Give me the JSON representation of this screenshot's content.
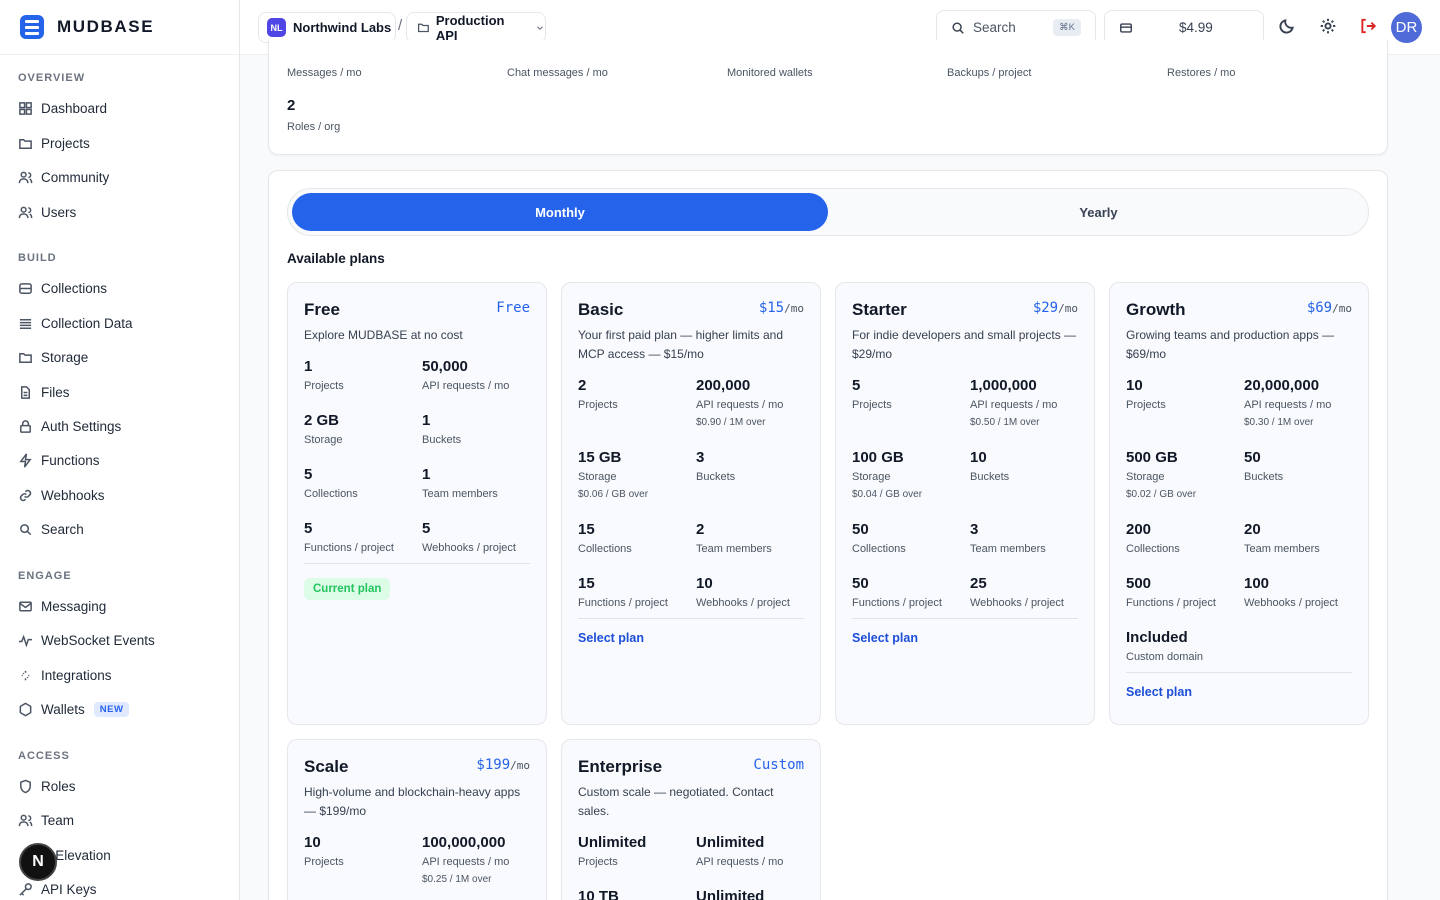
{
  "brand": {
    "name": "MUDBASE"
  },
  "sidebar": {
    "sections": [
      {
        "title": "OVERVIEW",
        "items": [
          {
            "label": "Dashboard",
            "icon": "grid-icon"
          },
          {
            "label": "Projects",
            "icon": "folder-icon"
          },
          {
            "label": "Community",
            "icon": "users-icon"
          },
          {
            "label": "Users",
            "icon": "users-icon"
          }
        ]
      },
      {
        "title": "BUILD",
        "items": [
          {
            "label": "Collections",
            "icon": "database-icon"
          },
          {
            "label": "Collection Data",
            "icon": "list-icon"
          },
          {
            "label": "Storage",
            "icon": "folder-icon"
          },
          {
            "label": "Files",
            "icon": "file-icon"
          },
          {
            "label": "Auth Settings",
            "icon": "lock-icon"
          },
          {
            "label": "Functions",
            "icon": "bolt-icon"
          },
          {
            "label": "Webhooks",
            "icon": "link-icon"
          },
          {
            "label": "Search",
            "icon": "search-icon"
          }
        ]
      },
      {
        "title": "ENGAGE",
        "items": [
          {
            "label": "Messaging",
            "icon": "mail-icon"
          },
          {
            "label": "WebSocket Events",
            "icon": "activity-icon"
          },
          {
            "label": "Integrations",
            "icon": "sparkle-icon"
          },
          {
            "label": "Wallets",
            "icon": "hexagon-icon",
            "badge": "NEW"
          }
        ]
      },
      {
        "title": "ACCESS",
        "items": [
          {
            "label": "Roles",
            "icon": "shield-icon"
          },
          {
            "label": "Team",
            "icon": "users-icon"
          },
          {
            "label": "le Elevation",
            "icon": ""
          },
          {
            "label": "API Keys",
            "icon": "key-icon"
          }
        ]
      }
    ],
    "fab_label": "N"
  },
  "topbar": {
    "org_initials": "NL",
    "org_name": "Northwind Labs",
    "separator": "/",
    "project_name": "Production API",
    "search_label": "Search",
    "search_shortcut": "⌘K",
    "credit": "$4.99",
    "user_initials": "DR"
  },
  "usage": {
    "row1": [
      {
        "label": "Messages / mo"
      },
      {
        "label": "Chat messages / mo"
      },
      {
        "label": "Monitored wallets"
      },
      {
        "label": "Backups / project"
      },
      {
        "label": "Restores / mo"
      }
    ],
    "row2": [
      {
        "value": "2",
        "label": "Roles / org"
      }
    ]
  },
  "billing": {
    "toggle": {
      "monthly": "Monthly",
      "yearly": "Yearly",
      "selected": "Monthly"
    },
    "section_title": "Available plans",
    "select_label": "Select plan",
    "current_label": "Current plan"
  },
  "plans": [
    {
      "name": "Free",
      "price": "Free",
      "period": "",
      "desc": "Explore MUDBASE at no cost",
      "features": [
        {
          "value": "1",
          "label": "Projects"
        },
        {
          "value": "50,000",
          "label": "API requests / mo"
        },
        {
          "value": "2 GB",
          "label": "Storage"
        },
        {
          "value": "1",
          "label": "Buckets"
        },
        {
          "value": "5",
          "label": "Collections"
        },
        {
          "value": "1",
          "label": "Team members"
        },
        {
          "value": "5",
          "label": "Functions / project"
        },
        {
          "value": "5",
          "label": "Webhooks / project"
        }
      ]
    },
    {
      "name": "Basic",
      "price": "$15",
      "period": "/mo",
      "desc": "Your first paid plan — higher limits and MCP access — $15/mo",
      "features": [
        {
          "value": "2",
          "label": "Projects"
        },
        {
          "value": "200,000",
          "label": "API requests / mo",
          "sub": "$0.90 / 1M over"
        },
        {
          "value": "15 GB",
          "label": "Storage",
          "sub": "$0.06 / GB over"
        },
        {
          "value": "3",
          "label": "Buckets"
        },
        {
          "value": "15",
          "label": "Collections"
        },
        {
          "value": "2",
          "label": "Team members"
        },
        {
          "value": "15",
          "label": "Functions / project"
        },
        {
          "value": "10",
          "label": "Webhooks / project"
        }
      ]
    },
    {
      "name": "Starter",
      "price": "$29",
      "period": "/mo",
      "desc": "For indie developers and small projects — $29/mo",
      "features": [
        {
          "value": "5",
          "label": "Projects"
        },
        {
          "value": "1,000,000",
          "label": "API requests / mo",
          "sub": "$0.50 / 1M over"
        },
        {
          "value": "100 GB",
          "label": "Storage",
          "sub": "$0.04 / GB over"
        },
        {
          "value": "10",
          "label": "Buckets"
        },
        {
          "value": "50",
          "label": "Collections"
        },
        {
          "value": "3",
          "label": "Team members"
        },
        {
          "value": "50",
          "label": "Functions / project"
        },
        {
          "value": "25",
          "label": "Webhooks / project"
        }
      ]
    },
    {
      "name": "Growth",
      "price": "$69",
      "period": "/mo",
      "desc": "Growing teams and production apps — $69/mo",
      "features": [
        {
          "value": "10",
          "label": "Projects"
        },
        {
          "value": "20,000,000",
          "label": "API requests / mo",
          "sub": "$0.30 / 1M over"
        },
        {
          "value": "500 GB",
          "label": "Storage",
          "sub": "$0.02 / GB over"
        },
        {
          "value": "50",
          "label": "Buckets"
        },
        {
          "value": "200",
          "label": "Collections"
        },
        {
          "value": "20",
          "label": "Team members"
        },
        {
          "value": "500",
          "label": "Functions / project"
        },
        {
          "value": "100",
          "label": "Webhooks / project"
        },
        {
          "value": "Included",
          "label": "Custom domain"
        }
      ]
    },
    {
      "name": "Scale",
      "price": "$199",
      "period": "/mo",
      "desc": "High-volume and blockchain-heavy apps — $199/mo",
      "features": [
        {
          "value": "10",
          "label": "Projects"
        },
        {
          "value": "100,000,000",
          "label": "API requests / mo",
          "sub": "$0.25 / 1M over"
        }
      ]
    },
    {
      "name": "Enterprise",
      "price": "Custom",
      "period": "",
      "desc": "Custom scale — negotiated. Contact sales.",
      "features": [
        {
          "value": "Unlimited",
          "label": "Projects"
        },
        {
          "value": "Unlimited",
          "label": "API requests / mo"
        },
        {
          "value": "10 TB",
          "label": ""
        },
        {
          "value": "Unlimited",
          "label": ""
        }
      ]
    }
  ],
  "colors": {
    "accent": "#2563eb",
    "success": "#22c55e",
    "dark": "#111111"
  }
}
